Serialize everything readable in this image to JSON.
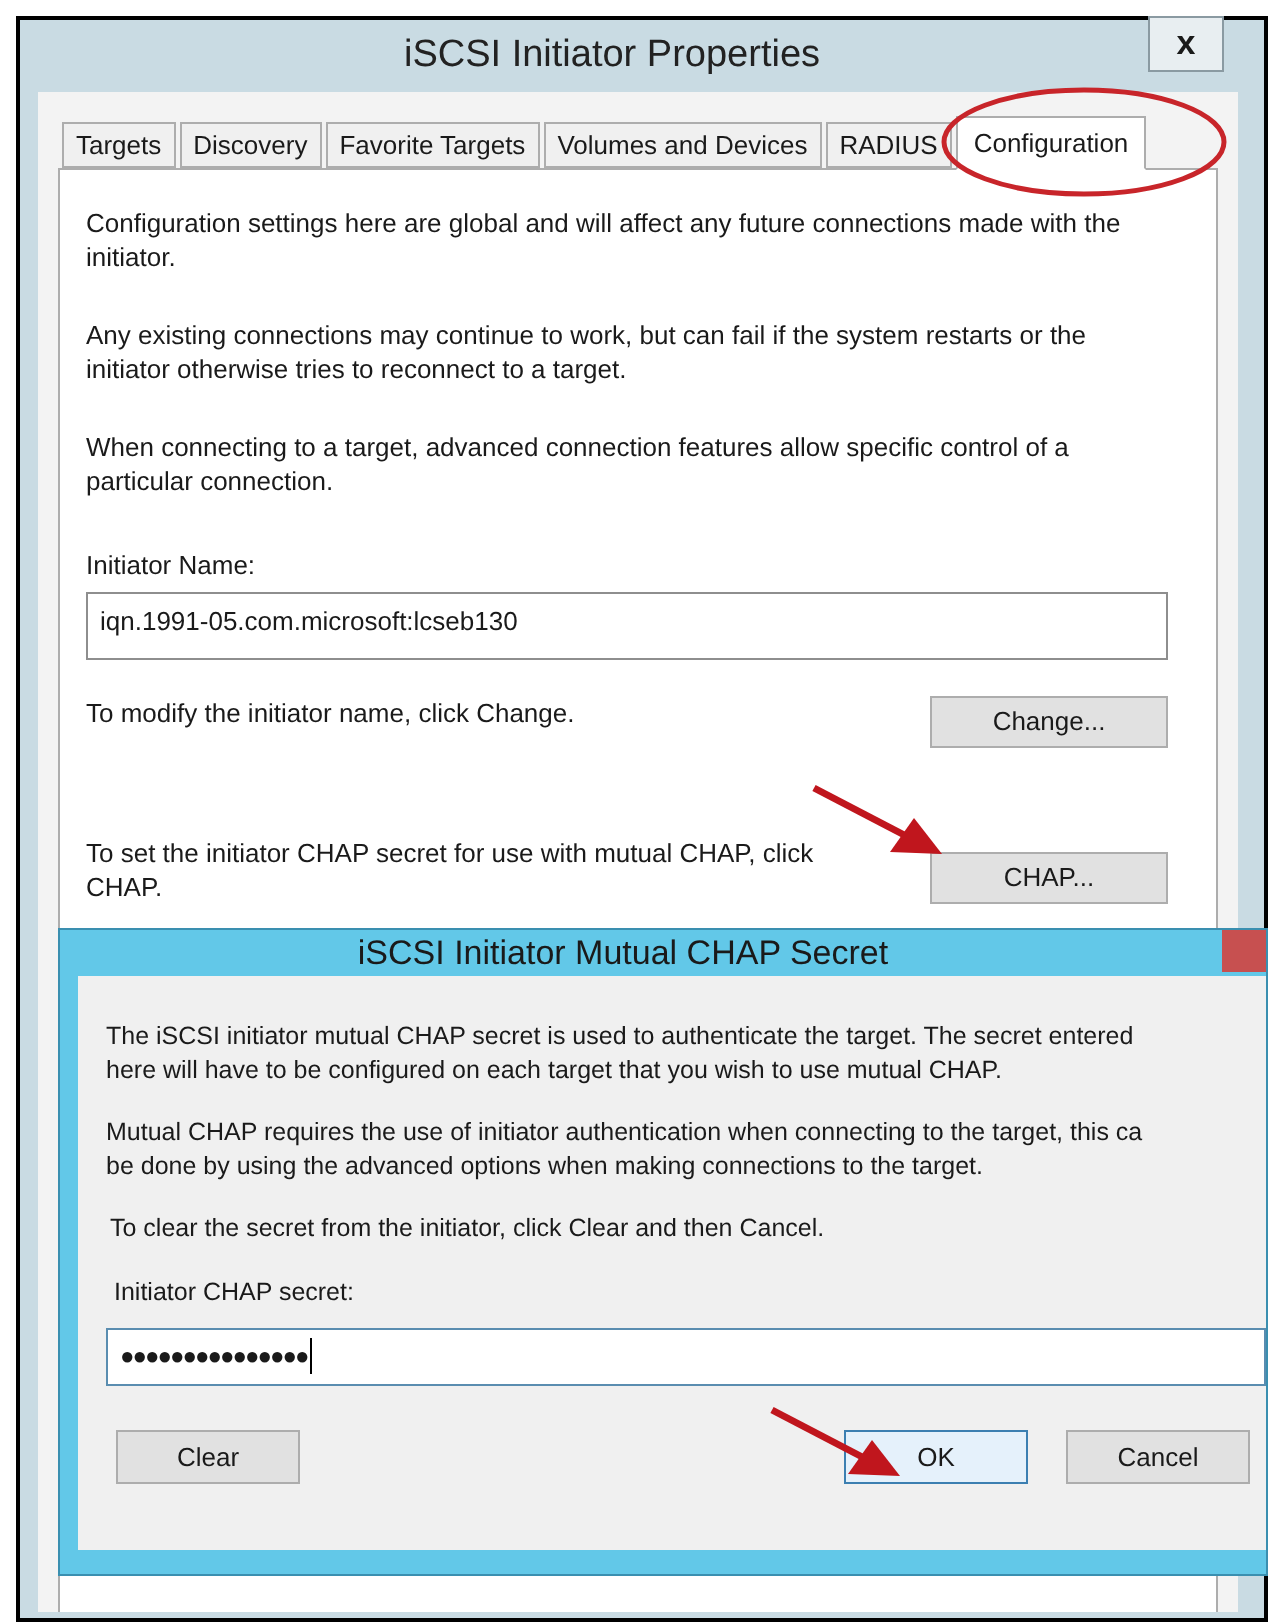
{
  "window": {
    "title": "iSCSI Initiator Properties",
    "close": "x"
  },
  "tabs": [
    {
      "label": "Targets",
      "selected": false
    },
    {
      "label": "Discovery",
      "selected": false
    },
    {
      "label": "Favorite Targets",
      "selected": false
    },
    {
      "label": "Volumes and Devices",
      "selected": false
    },
    {
      "label": "RADIUS",
      "selected": false
    },
    {
      "label": "Configuration",
      "selected": true
    }
  ],
  "paragraphs": [
    "Configuration settings here are global and will affect any future connections made with the initiator.",
    "Any existing connections may continue to work, but can fail if the system restarts or the initiator otherwise tries to reconnect to a target.",
    "When connecting to a target, advanced connection features allow specific control of a particular connection."
  ],
  "initiator_name": {
    "label": "Initiator Name:",
    "value": "iqn.1991-05.com.microsoft:lcseb130"
  },
  "actions": [
    {
      "text": "To modify the initiator name, click Change.",
      "button": "Change..."
    },
    {
      "text": "To set the initiator CHAP secret for use with mutual CHAP, click CHAP.",
      "button": "CHAP..."
    }
  ],
  "dialog": {
    "title": "iSCSI Initiator Mutual CHAP Secret",
    "paragraphs": [
      [
        "The iSCSI initiator mutual CHAP secret is used to authenticate the target.  The secret entered",
        "here will have to be configured on each target that you wish to use mutual CHAP."
      ],
      [
        "Mutual CHAP requires the use of initiator authentication when connecting to the target, this ca",
        "be done by using the advanced options when making connections to the target."
      ],
      [
        "To clear the secret from the initiator, click Clear and then Cancel."
      ]
    ],
    "secret": {
      "label": "Initiator CHAP secret:",
      "value": "●●●●●●●●●●●●●●●"
    },
    "buttons": [
      {
        "label": "Clear",
        "default": false
      },
      {
        "label": "OK",
        "default": true
      },
      {
        "label": "Cancel",
        "default": false
      }
    ]
  }
}
